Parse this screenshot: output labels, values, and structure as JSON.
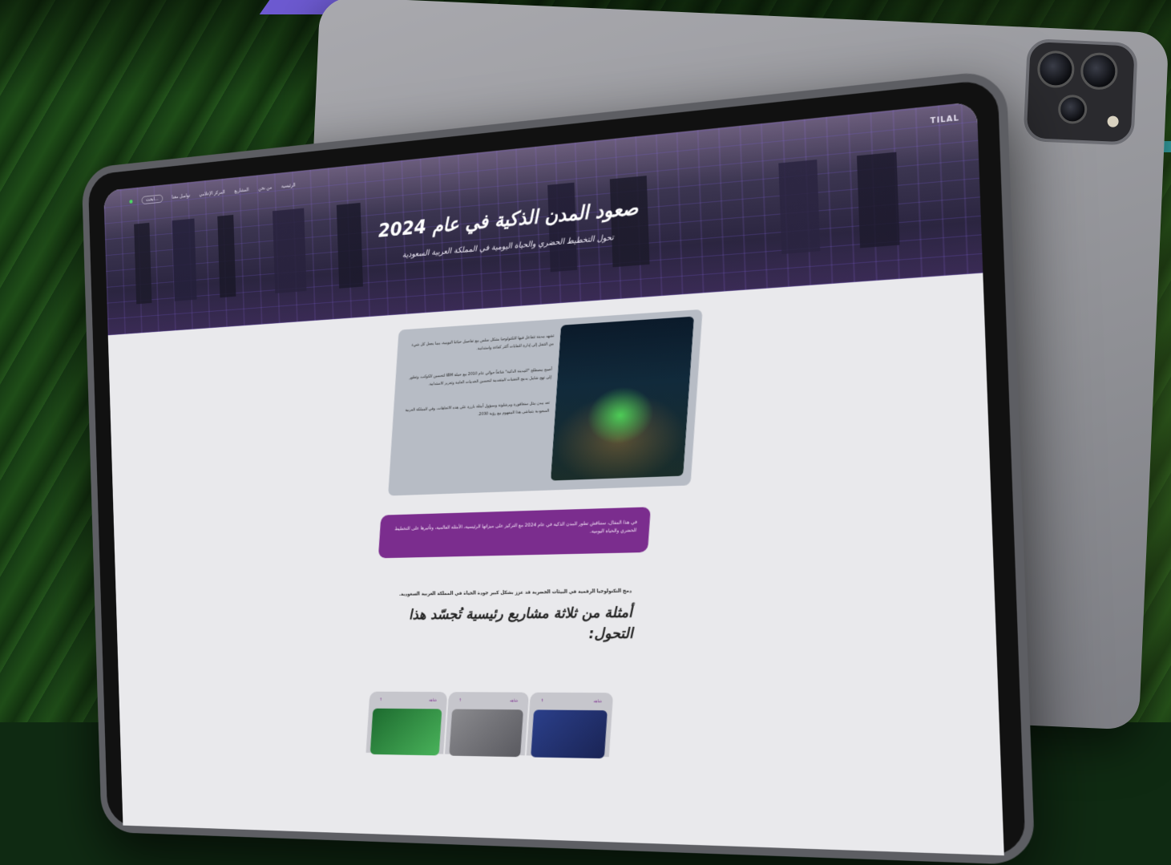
{
  "nav": {
    "brand": "TILAL",
    "items": [
      "الرئيسية",
      "من نحن",
      "المشاريع",
      "المركز الإعلامي",
      "تواصل معنا"
    ],
    "search": "ابحث..."
  },
  "hero": {
    "title": "صعود المدن الذكية في عام 2024",
    "subtitle": "تحول التخطيط الحضري والحياة اليومية في المملكة العربية السعودية"
  },
  "card": {
    "paragraphs": [
      "تشهد مدينة تتفاعل فيها التكنولوجيا بشكل سلس مع تفاصيل حياتنا اليومية، مما يجعل كل شيء من التنقل إلى إدارة النفايات أكثر كفاءة واستدامة.",
      "أصبح مصطلح \"المدينة الذكية\" شائعاً حوالي عام 2010 مع حملة IBM لتحسين الكوكب، وتطور إلى نهج شامل يدمج التقنيات المتقدمة لتحسين الخدمات العامة وتعزيز الاستدامة.",
      "تعد مدن مثل سنغافورة وبرشلونة وسيؤول أمثلة بارزة على هذه الاتجاهات، وفي المملكة العربية السعودية يتماشى هذا المفهوم مع رؤية 2030."
    ]
  },
  "banner": {
    "text": "في هذا المقال، سنناقش تطور المدن الذكية في عام 2024 مع التركيز على ميزاتها الرئيسية، الأمثلة العالمية، وتأثيرها على التخطيط الحضري والحياة اليومية."
  },
  "section": {
    "intro": "دمج التكنولوجيا الرقمية في البيئات الحضرية قد عزز بشكل كبير جودة الحياة في المملكة العربية السعودية.",
    "heading": "أمثلة من ثلاثة مشاريع رئيسية تُجسّد هذا التحول:"
  },
  "projects": [
    {
      "label": "شاهد"
    },
    {
      "label": "شاهد"
    },
    {
      "label": "شاهد"
    }
  ],
  "colors": {
    "accent": "#7b2d8e",
    "hero_dark": "#2b2540",
    "page_bg": "#e9e9ec"
  }
}
